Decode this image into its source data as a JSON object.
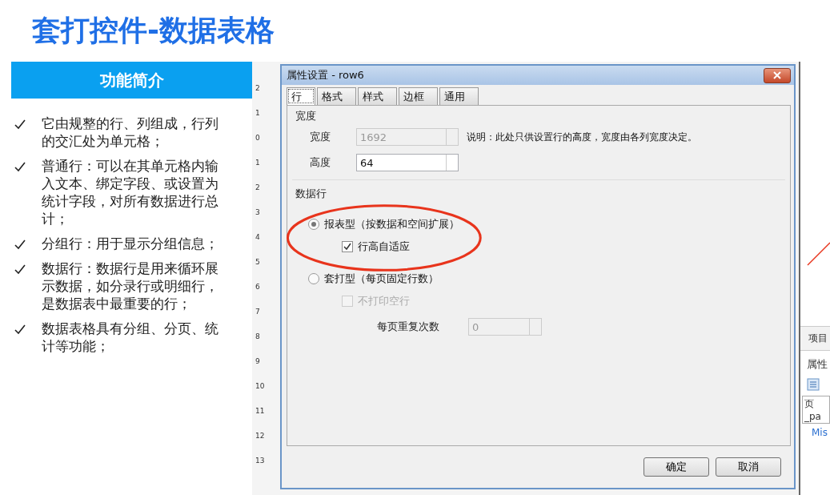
{
  "title": "套打控件-数据表格",
  "intro": {
    "heading": "功能简介",
    "items": [
      "它由规整的行、列组成，行列的交汇处为单元格；",
      "普通行：可以在其单元格内输入文本、绑定字段、或设置为统计字段，对所有数据进行总计；",
      "分组行：用于显示分组信息；",
      "数据行：数据行是用来循环展示数据，如分录行或明细行，是数据表中最重要的行；",
      "数据表格具有分组、分页、统计等功能；"
    ]
  },
  "ruler": {
    "labels": [
      "2",
      "1",
      "0",
      "1",
      "2",
      "3",
      "4",
      "5",
      "6",
      "7",
      "8",
      "9",
      "10",
      "11",
      "12",
      "13"
    ]
  },
  "dialog": {
    "title": "属性设置 - row6",
    "tabs": [
      {
        "label": "行",
        "selected": true
      },
      {
        "label": "格式",
        "selected": false
      },
      {
        "label": "样式",
        "selected": false
      },
      {
        "label": "边框",
        "selected": false
      },
      {
        "label": "通用",
        "selected": false
      }
    ],
    "size_group": {
      "legend": "宽度",
      "fields": [
        {
          "label": "宽度",
          "value": "1692",
          "disabled": true
        },
        {
          "label": "高度",
          "value": "64",
          "disabled": false
        }
      ],
      "note": "说明：此处只供设置行的高度，宽度由各列宽度决定。"
    },
    "data_row_group": {
      "legend": "数据行",
      "options": [
        {
          "kind": "radio",
          "label": "报表型（按数据和空间扩展）",
          "selected": true,
          "highlighted": true,
          "children": [
            {
              "kind": "checkbox",
              "label": "行高自适应",
              "checked": true,
              "disabled": false
            }
          ]
        },
        {
          "kind": "radio",
          "label": "套打型（每页固定行数）",
          "selected": false,
          "children": [
            {
              "kind": "checkbox",
              "label": "不打印空行",
              "checked": false,
              "disabled": true
            },
            {
              "kind": "spinner",
              "label": "每页重复次数",
              "value": "0",
              "disabled": true
            }
          ]
        }
      ]
    },
    "buttons": [
      "确定",
      "取消"
    ]
  },
  "side_panel": {
    "tab": "项目",
    "header": "属性",
    "field": "页_pa",
    "category": "Mis"
  }
}
